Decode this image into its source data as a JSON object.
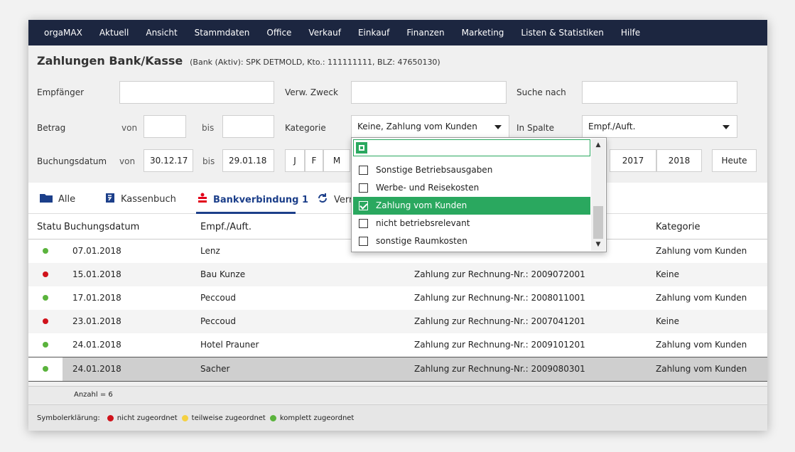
{
  "menu": [
    "orgaMAX",
    "Aktuell",
    "Ansicht",
    "Stammdaten",
    "Office",
    "Verkauf",
    "Einkauf",
    "Finanzen",
    "Marketing",
    "Listen & Statistiken",
    "Hilfe"
  ],
  "header": {
    "title": "Zahlungen Bank/Kasse",
    "subtitle": "(Bank (Aktiv): SPK DETMOLD, Kto.: 111111111, BLZ: 47650130)"
  },
  "filters": {
    "empfaenger_label": "Empfänger",
    "empfaenger_value": "",
    "verwzweck_label": "Verw. Zweck",
    "verwzweck_value": "",
    "suche_label": "Suche nach",
    "suche_value": "",
    "betrag_label": "Betrag",
    "von_label": "von",
    "bis_label": "bis",
    "betrag_von": "",
    "betrag_bis": "",
    "kategorie_label": "Kategorie",
    "kategorie_value": "Keine, Zahlung vom Kunden",
    "inspalte_label": "In Spalte",
    "inspalte_value": "Empf./Auft.",
    "buchungsdatum_label": "Buchungsdatum",
    "datum_von": "30.12.17",
    "datum_bis": "29.01.18",
    "months": [
      "J",
      "F",
      "M"
    ],
    "years": [
      "2017",
      "2018"
    ],
    "heute_label": "Heute"
  },
  "tabs": [
    {
      "label": "Alle",
      "icon": "folder-icon"
    },
    {
      "label": "Kassenbuch",
      "icon": "cashbook-icon"
    },
    {
      "label": "Bankverbindung 1",
      "icon": "bank-icon"
    },
    {
      "label": "Verr",
      "icon": "sync-icon"
    }
  ],
  "table": {
    "columns": [
      "Statu",
      "Buchungsdatum",
      "Empf./Auft.",
      "Kategorie"
    ],
    "rows": [
      {
        "status": "green",
        "date": "07.01.2018",
        "recipient": "Lenz",
        "purpose": "",
        "category": "Zahlung vom Kunden"
      },
      {
        "status": "red",
        "date": "15.01.2018",
        "recipient": "Bau Kunze",
        "purpose": "Zahlung zur Rechnung-Nr.: 2009072001",
        "category": "Keine"
      },
      {
        "status": "green",
        "date": "17.01.2018",
        "recipient": "Peccoud",
        "purpose": "Zahlung zur Rechnung-Nr.: 2008011001",
        "category": "Zahlung vom Kunden"
      },
      {
        "status": "red",
        "date": "23.01.2018",
        "recipient": "Peccoud",
        "purpose": "Zahlung zur Rechnung-Nr.: 2007041201",
        "category": "Keine"
      },
      {
        "status": "green",
        "date": "24.01.2018",
        "recipient": "Hotel Prauner",
        "purpose": "Zahlung zur Rechnung-Nr.: 2009101201",
        "category": "Zahlung vom Kunden"
      },
      {
        "status": "green",
        "date": "24.01.2018",
        "recipient": "Sacher",
        "purpose": "Zahlung zur Rechnung-Nr.: 2009080301",
        "category": "Zahlung vom Kunden"
      }
    ],
    "count_label": "Anzahl = 6"
  },
  "legend": {
    "title": "Symbolerklärung:",
    "items": [
      {
        "label": "nicht zugeordnet",
        "color": "#d0121b"
      },
      {
        "label": "teilweise zugeordnet",
        "color": "#f5d142"
      },
      {
        "label": "komplett zugeordnet",
        "color": "#5ab33c"
      }
    ]
  },
  "dropdown": {
    "search_value": "",
    "items": [
      {
        "label": "Sonstige Betriebsausgaben",
        "checked": false
      },
      {
        "label": "Werbe- und Reisekosten",
        "checked": false
      },
      {
        "label": "Zahlung vom Kunden",
        "checked": true
      },
      {
        "label": "nicht betriebsrelevant",
        "checked": false
      },
      {
        "label": "sonstige Raumkosten",
        "checked": false
      }
    ]
  },
  "colors": {
    "menubar": "#1c2640",
    "accent": "#2aa85f",
    "tab_active": "#1c3f8a",
    "status_green": "#5ab33c",
    "status_red": "#d0121b"
  }
}
